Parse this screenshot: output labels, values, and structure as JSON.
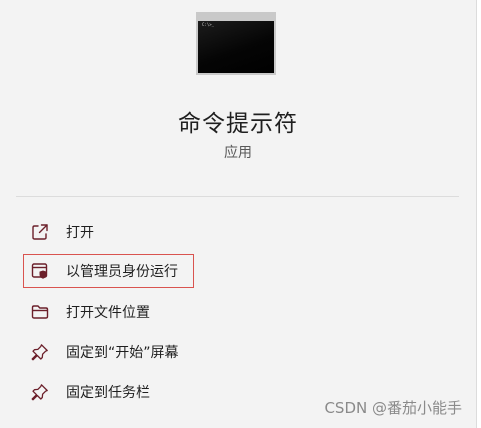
{
  "app": {
    "name": "命令提示符",
    "type": "应用",
    "console_prompt": "C:\\>_",
    "icon": "command-prompt-icon"
  },
  "menu": {
    "items": [
      {
        "label": "打开",
        "icon": "open-external-icon"
      },
      {
        "label": "以管理员身份运行",
        "icon": "run-as-admin-shield-icon"
      },
      {
        "label": "打开文件位置",
        "icon": "folder-icon"
      },
      {
        "label": "固定到“开始”屏幕",
        "icon": "pin-icon"
      },
      {
        "label": "固定到任务栏",
        "icon": "pin-icon"
      }
    ]
  },
  "watermark": {
    "text": "CSDN @番茄小能手"
  },
  "colors": {
    "background": "#f3f3f3",
    "icon_stroke": "#6b1f2a",
    "highlight_border": "#d9534f",
    "divider": "#dcdcdc"
  }
}
